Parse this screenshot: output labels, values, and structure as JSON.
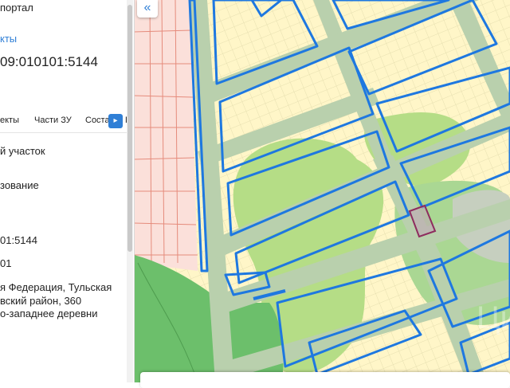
{
  "panel": {
    "portal_title": "портал",
    "objects_link": "кты",
    "cadastral_number": "09:010101:5144",
    "tabs": [
      "екты",
      "Части ЗУ",
      "Соста",
      "П"
    ],
    "tab_next": "▸",
    "type_value": "й участок",
    "usage_value": "зование",
    "number_short": "01:5144",
    "code_short": "01",
    "address_lines": [
      "я Федерация, Тульская",
      "вский район, 360",
      "о-западнее деревни"
    ]
  },
  "map": {
    "collapse_label": "«",
    "watermark": "Циан"
  },
  "colors": {
    "parcel_border": "#1e78e0",
    "road": "#b9d0ad",
    "base": "#fff6c8",
    "vegetation": "#b5dd86",
    "forest": "#6cbf6b",
    "settlement": "#fbe0da",
    "selected_parcel": "#8e2c5e"
  }
}
